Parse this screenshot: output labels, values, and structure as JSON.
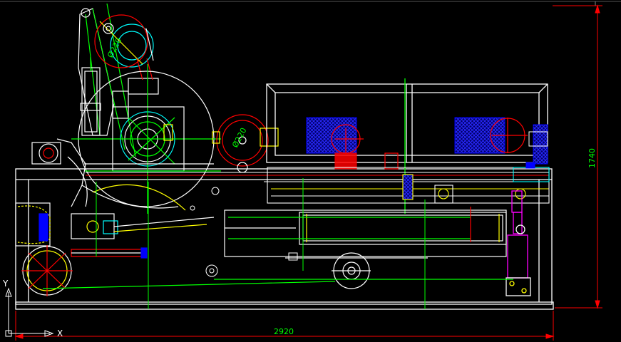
{
  "drawing": {
    "dimensions": {
      "overall_width": "2920",
      "overall_height": "1740",
      "roll_diameter_top": "Ø220",
      "roll_diameter_mid": "Ø220"
    },
    "ucs": {
      "x_label": "X",
      "y_label": "Y"
    },
    "colors": {
      "background": "#000000",
      "frame": "#ffffff",
      "centerline": "#00ff00",
      "hidden": "#00ffff",
      "roller": "#ff0000",
      "guard": "#ffff00",
      "hatch_blue": "#0000ff",
      "cylinder": "#ff00ff",
      "dim": "#ff0000"
    }
  }
}
